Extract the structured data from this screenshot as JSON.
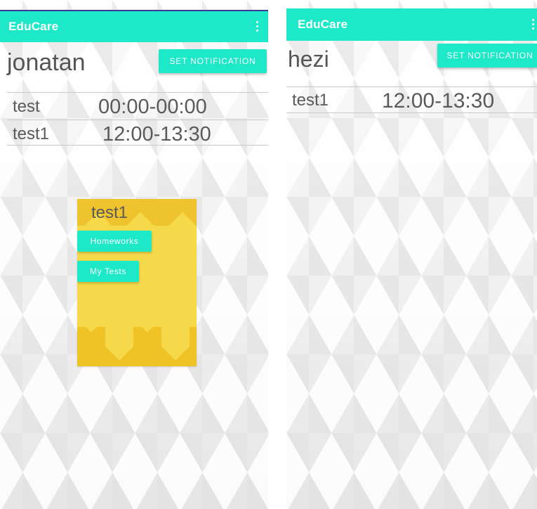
{
  "left_screen": {
    "app_title": "EduCare",
    "username": "jonatan",
    "set_notification_label": "SET NOTIFICATION",
    "schedule": [
      {
        "name": "test",
        "time": "00:00-00:00"
      },
      {
        "name": "test1",
        "time": "12:00-13:30"
      }
    ],
    "course_card": {
      "title": "test1",
      "homeworks_label": "Homeworks",
      "my_tests_label": "My Tests"
    }
  },
  "right_screen": {
    "app_title": "EduCare",
    "username": "hezi",
    "set_notification_label": "SET NOTIFICATION",
    "schedule": [
      {
        "name": "test1",
        "time": "12:00-13:30"
      }
    ]
  },
  "colors": {
    "accent": "#1de9c8",
    "card": "#f5d94a",
    "card_shade": "#eec12a",
    "text": "#5a5a5a"
  },
  "icons": [
    "overflow-menu-icon"
  ]
}
